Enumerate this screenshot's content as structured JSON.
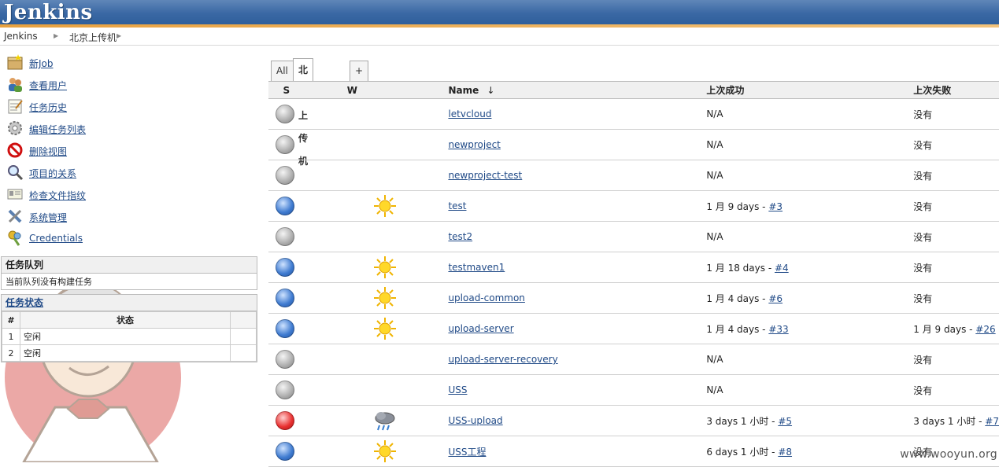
{
  "header": {
    "logo": "Jenkins"
  },
  "breadcrumbs": [
    "Jenkins",
    "北京上传机"
  ],
  "tasks": [
    {
      "label": "新Job",
      "icon": "new-job-icon"
    },
    {
      "label": "查看用户",
      "icon": "people-icon"
    },
    {
      "label": "任务历史",
      "icon": "build-history-icon"
    },
    {
      "label": "编辑任务列表",
      "icon": "gear-icon"
    },
    {
      "label": "删除视图",
      "icon": "delete-icon"
    },
    {
      "label": "项目的关系",
      "icon": "search-icon"
    },
    {
      "label": "检查文件指纹",
      "icon": "fingerprint-icon"
    },
    {
      "label": "系统管理",
      "icon": "tools-icon"
    },
    {
      "label": "Credentials",
      "icon": "keys-icon"
    }
  ],
  "build_queue": {
    "title": "任务队列",
    "message": "当前队列没有构建任务"
  },
  "executors": {
    "title": "任务状态",
    "headers": [
      "#",
      "状态"
    ],
    "rows": [
      {
        "num": "1",
        "status": "空闲"
      },
      {
        "num": "2",
        "status": "空闲"
      }
    ]
  },
  "tabs": [
    "All",
    "北京上传机",
    "+"
  ],
  "table_headers": {
    "s": "S",
    "w": "W",
    "name": "Name",
    "sort_arrow": "↓",
    "last_success": "上次成功",
    "last_failure": "上次失败"
  },
  "colors": {
    "header_blue": "#3a68a4",
    "accent_orange": "#e8a13f",
    "link": "#204a87"
  },
  "jobs": [
    {
      "name": "letvcloud",
      "status": "grey",
      "weather": "",
      "success_text": "N/A",
      "success_link": "",
      "failure_text": "没有",
      "failure_link": ""
    },
    {
      "name": "newproject",
      "status": "grey",
      "weather": "",
      "success_text": "N/A",
      "success_link": "",
      "failure_text": "没有",
      "failure_link": ""
    },
    {
      "name": "newproject-test",
      "status": "grey",
      "weather": "",
      "success_text": "N/A",
      "success_link": "",
      "failure_text": "没有",
      "failure_link": ""
    },
    {
      "name": "test",
      "status": "blue",
      "weather": "sunny",
      "success_text": "1 月 9 days - ",
      "success_link": "#3",
      "failure_text": "没有",
      "failure_link": ""
    },
    {
      "name": "test2",
      "status": "grey",
      "weather": "",
      "success_text": "N/A",
      "success_link": "",
      "failure_text": "没有",
      "failure_link": ""
    },
    {
      "name": "testmaven1",
      "status": "blue",
      "weather": "sunny",
      "success_text": "1 月 18 days - ",
      "success_link": "#4",
      "failure_text": "没有",
      "failure_link": ""
    },
    {
      "name": "upload-common",
      "status": "blue",
      "weather": "sunny",
      "success_text": "1 月 4 days - ",
      "success_link": "#6",
      "failure_text": "没有",
      "failure_link": ""
    },
    {
      "name": "upload-server",
      "status": "blue",
      "weather": "sunny",
      "success_text": "1 月 4 days - ",
      "success_link": "#33",
      "failure_text": "1 月 9 days - ",
      "failure_link": "#26"
    },
    {
      "name": "upload-server-recovery",
      "status": "grey",
      "weather": "",
      "success_text": "N/A",
      "success_link": "",
      "failure_text": "没有",
      "failure_link": ""
    },
    {
      "name": "USS",
      "status": "grey",
      "weather": "",
      "success_text": "N/A",
      "success_link": "",
      "failure_text": "没有",
      "failure_link": ""
    },
    {
      "name": "USS-upload",
      "status": "red",
      "weather": "rain",
      "success_text": "3 days 1 小时 - ",
      "success_link": "#5",
      "failure_text": "3 days 1 小时 - ",
      "failure_link": "#7"
    },
    {
      "name": "USS工程",
      "status": "blue",
      "weather": "sunny",
      "success_text": "6 days 1 小时 - ",
      "success_link": "#8",
      "failure_text": "没有",
      "failure_link": ""
    }
  ],
  "watermark": "www.wooyun.org"
}
